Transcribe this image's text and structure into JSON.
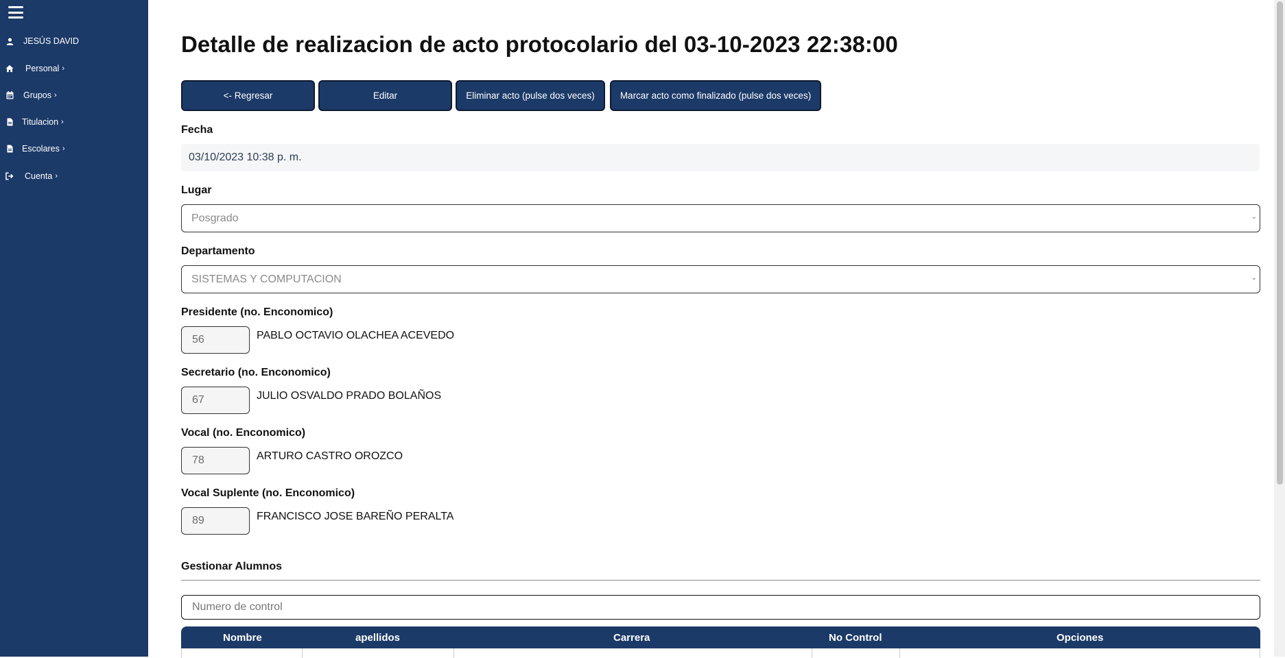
{
  "sidebar": {
    "user": "JESÚS DAVID",
    "items": [
      {
        "label": "Personal",
        "icon": "home-icon"
      },
      {
        "label": "Grupos",
        "icon": "calendar-icon"
      },
      {
        "label": "Titulacion",
        "icon": "document-icon"
      },
      {
        "label": "Escolares",
        "icon": "document-icon"
      },
      {
        "label": "Cuenta",
        "icon": "logout-icon"
      }
    ],
    "chevron": "›"
  },
  "page": {
    "title": "Detalle de realizacion de acto protocolario del 03-10-2023 22:38:00"
  },
  "buttons": {
    "back": "<- Regresar",
    "edit": "Editar",
    "delete": "Eliminar acto (pulse dos veces)",
    "finish": "Marcar acto como finalizado (pulse dos veces)"
  },
  "form": {
    "fecha_label": "Fecha",
    "fecha_value": "03/10/2023 10:38 p. m.",
    "lugar_label": "Lugar",
    "lugar_value": "Posgrado",
    "departamento_label": "Departamento",
    "departamento_value": "SISTEMAS Y COMPUTACION",
    "jurado": [
      {
        "label": "Presidente (no. Enconomico)",
        "number": "56",
        "name": "PABLO OCTAVIO OLACHEA ACEVEDO"
      },
      {
        "label": "Secretario (no. Enconomico)",
        "number": "67",
        "name": "JULIO OSVALDO PRADO BOLAÑOS"
      },
      {
        "label": "Vocal (no. Enconomico)",
        "number": "78",
        "name": "ARTURO CASTRO OROZCO"
      },
      {
        "label": "Vocal Suplente (no. Enconomico)",
        "number": "89",
        "name": "FRANCISCO JOSE BAREÑO PERALTA"
      }
    ]
  },
  "alumnos": {
    "heading": "Gestionar Alumnos",
    "search_placeholder": "Numero de control",
    "columns": [
      "Nombre",
      "apellidos",
      "Carrera",
      "No Control",
      "Opciones"
    ]
  },
  "colors": {
    "sidebar": "#1c3a68",
    "accent": "#1c3a68"
  }
}
